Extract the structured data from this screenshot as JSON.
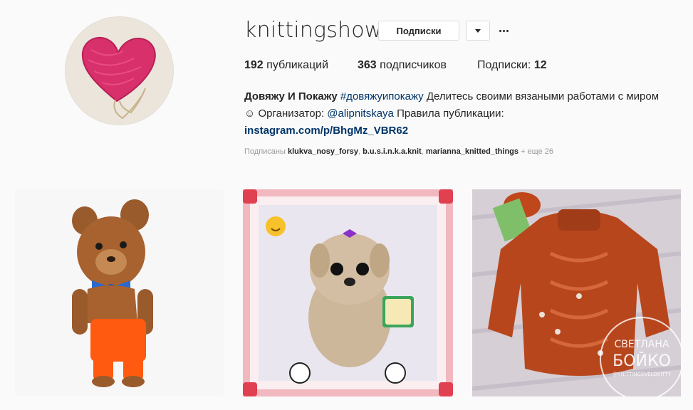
{
  "profile": {
    "username": "knittingshow",
    "follow_label": "Подписки",
    "stats": {
      "posts_count": "192",
      "posts_label": "публикаций",
      "followers_count": "363",
      "followers_label": "подписчиков",
      "following_label": "Подписки:",
      "following_count": "12"
    },
    "bio": {
      "name": "Довяжу И Покажу",
      "hashtag": "#довяжуипокажу",
      "text1": "Делитесь своими вязаными работами с миром",
      "emoji": "☺",
      "text2": "Организатор:",
      "mention": "@alipnitskaya",
      "text3": "Правила публикации:",
      "url": "instagram.com/p/BhgMz_VBR62"
    },
    "followed_by": {
      "prefix": "Подписаны",
      "users": [
        "klukva_nosy_forsy",
        "b.u.s.i.n.k.a.knit",
        "marianna_knitted_things"
      ],
      "more": "+ еще 26"
    }
  },
  "posts": [
    {
      "subject": "knitted-teddy-bear"
    },
    {
      "subject": "knitted-puppy-toy"
    },
    {
      "subject": "knitted-orange-sweater",
      "watermark_line1": "СВЕТЛАНА",
      "watermark_line2": "БОЙКО",
      "watermark_line3": "@KNITTINGSVELOKITTY"
    }
  ],
  "colors": {
    "background": "#fafafa",
    "text": "#262626",
    "link": "#003569",
    "muted": "#999999",
    "border": "#dbdbdb"
  }
}
